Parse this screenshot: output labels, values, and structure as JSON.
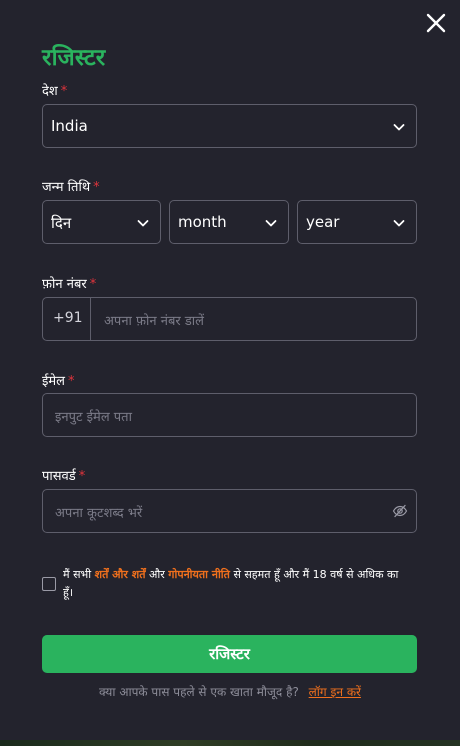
{
  "modal": {
    "title": "रजिस्टर",
    "close_icon": "close-icon"
  },
  "form": {
    "required_marker": "*",
    "country": {
      "label": "देश",
      "selected": "India"
    },
    "dob": {
      "label": "जन्म तिथि",
      "day_selected": "दिन",
      "month_selected": "month",
      "year_selected": "year"
    },
    "phone": {
      "label": "फ़ोन नंबर",
      "country_code": "+91",
      "placeholder": "अपना फ़ोन नंबर डालें"
    },
    "email": {
      "label": "ईमेल",
      "placeholder": "इनपुट ईमेल पता"
    },
    "password": {
      "label": "पासवर्ड",
      "placeholder": "अपना कूटशब्द भरें",
      "toggle_icon": "eye-off-icon"
    },
    "consent": {
      "text_before": "मैं सभी",
      "terms_link": "शर्तें और शर्तें",
      "text_and": "और",
      "privacy_link": "गोपनीयता नीति",
      "text_after": "से सहमत हूँ और मैं 18 वर्ष से अधिक का हूँ।"
    },
    "submit_label": "रजिस्टर",
    "login_prompt": "क्या आपके पास पहले से एक खाता मौजूद है?",
    "login_link": "लॉग इन करें"
  },
  "colors": {
    "accent_green": "#2ab35e",
    "link_orange": "#f0701d",
    "required_red": "#e0343c",
    "background": "#23232d"
  }
}
